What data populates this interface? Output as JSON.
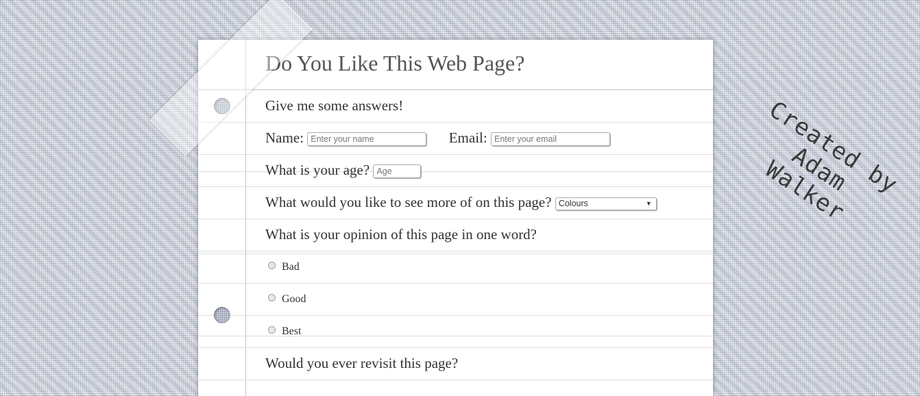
{
  "title": "Do You Like This Web Page?",
  "intro": "Give me some answers!",
  "name_label": "Name:",
  "name_placeholder": "Enter your name",
  "email_label": "Email:",
  "email_placeholder": "Enter your email",
  "age_label": "What is your age?",
  "age_placeholder": "Age",
  "more_label": "What would you like to see more of on this page?",
  "more_selected": "Colours",
  "opinion_label": "What is your opinion of this page in one word?",
  "options": [
    "Bad",
    "Good",
    "Best"
  ],
  "revisit_label": "Would you ever revisit this page?",
  "signature_line1": "Created by",
  "signature_line2": "Adam Walker"
}
